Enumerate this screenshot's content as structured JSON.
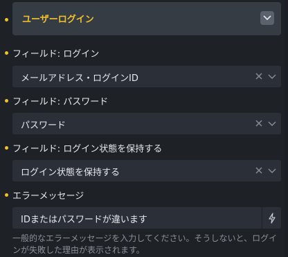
{
  "header": {
    "title": "ユーザーログイン"
  },
  "fields": [
    {
      "label": "フィールド: ログイン",
      "value": "メールアドレス・ログインID"
    },
    {
      "label": "フィールド: パスワード",
      "value": "パスワード"
    },
    {
      "label": "フィールド: ログイン状態を保持する",
      "value": "ログイン状態を保持する"
    }
  ],
  "error": {
    "label": "エラーメッセージ",
    "value": "IDまたはパスワードが違います",
    "help": "一般的なエラーメッセージを入力してください。そうしないと、ログインが失敗した理由が表示されます。"
  },
  "icons": {
    "toggle": "chevron-down-icon",
    "clear": "close-icon",
    "dropdown": "chevron-down-icon",
    "dynamic": "lightning-icon"
  },
  "colors": {
    "accent": "#f2c230",
    "background": "#1e2227",
    "field": "#2b3038"
  }
}
